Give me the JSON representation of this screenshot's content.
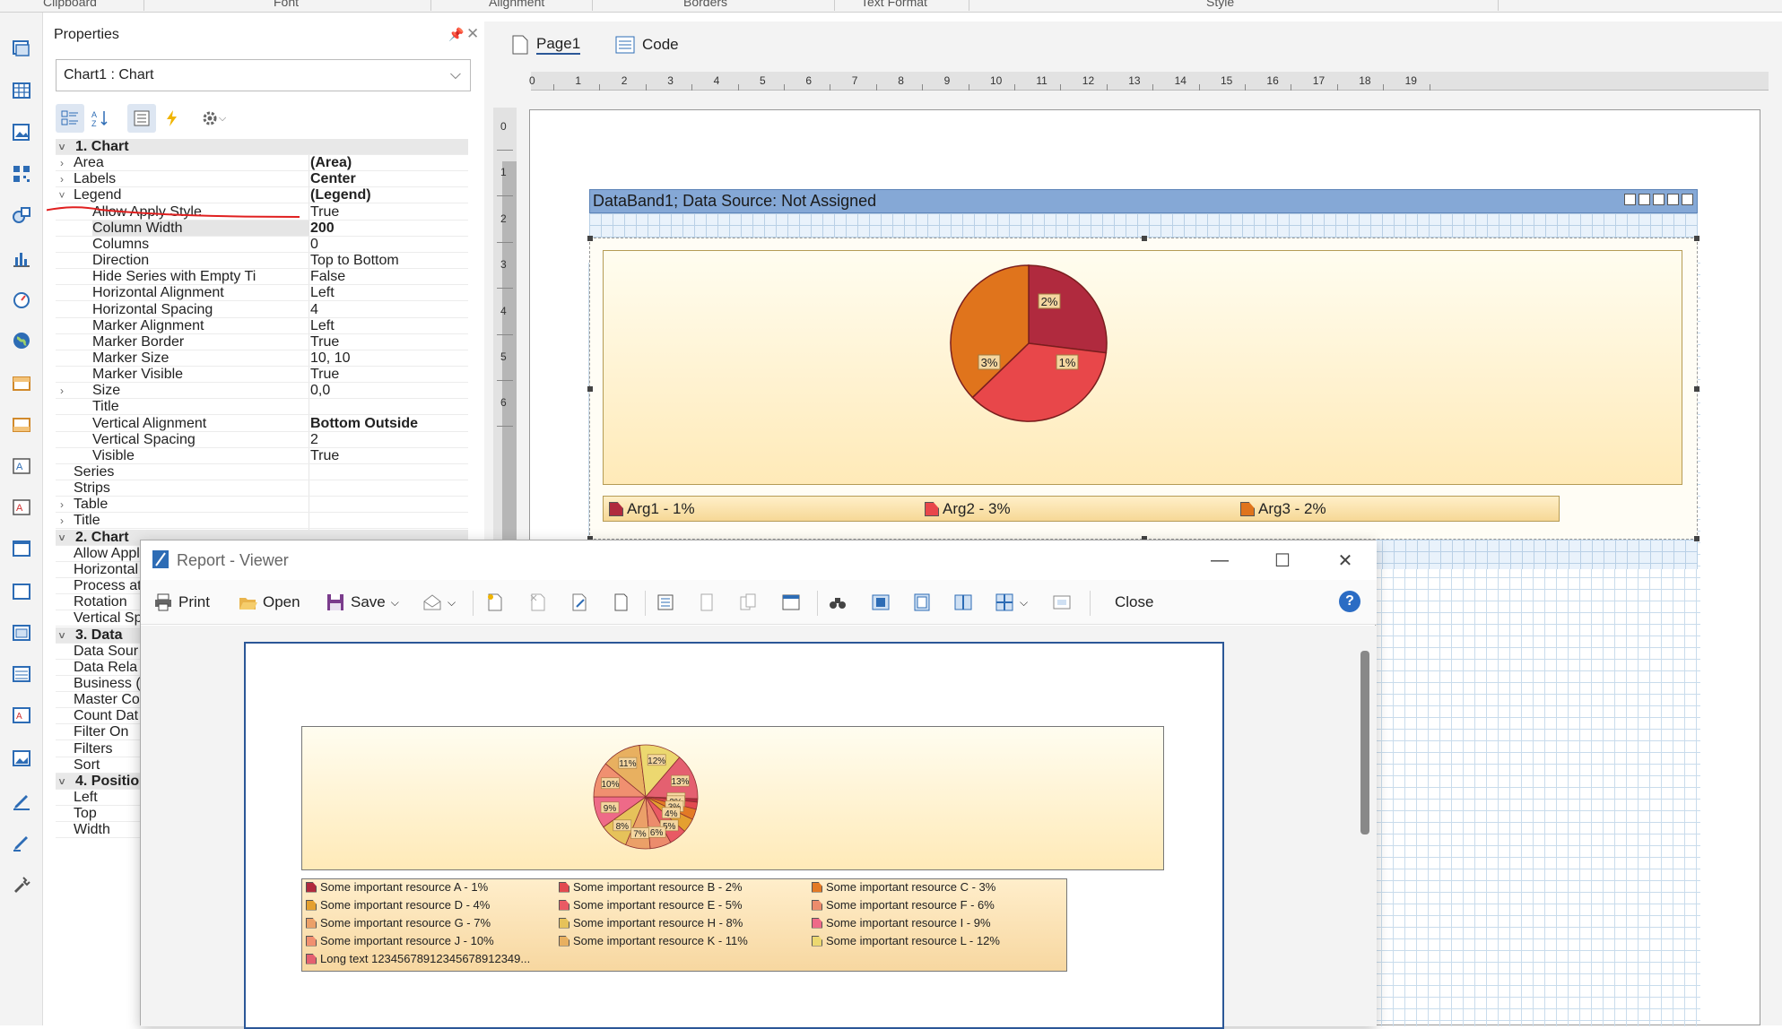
{
  "ribbon": {
    "groups": [
      "Clipboard",
      "Font",
      "Alignment",
      "Borders",
      "Text Format",
      "Style"
    ]
  },
  "properties": {
    "title": "Properties",
    "selected_component": "Chart1 : Chart",
    "rows": [
      {
        "kind": "cat",
        "expander": "˅",
        "name": "1. Chart",
        "value": ""
      },
      {
        "kind": "top",
        "expander": "›",
        "name": "Area",
        "value": "(Area)",
        "bold": true
      },
      {
        "kind": "top",
        "expander": "›",
        "name": "Labels",
        "value": "Center",
        "bold": true
      },
      {
        "kind": "top",
        "expander": "˅",
        "name": "Legend",
        "value": "(Legend)",
        "bold": true
      },
      {
        "kind": "sub",
        "expander": "",
        "name": "Allow Apply Style",
        "value": "True"
      },
      {
        "kind": "sub",
        "expander": "",
        "name": "Column Width",
        "value": "200",
        "bold": true,
        "selected": true
      },
      {
        "kind": "sub",
        "expander": "",
        "name": "Columns",
        "value": "0"
      },
      {
        "kind": "sub",
        "expander": "",
        "name": "Direction",
        "value": "Top to Bottom"
      },
      {
        "kind": "sub",
        "expander": "",
        "name": "Hide Series with Empty Ti",
        "value": "False"
      },
      {
        "kind": "sub",
        "expander": "",
        "name": "Horizontal Alignment",
        "value": "Left"
      },
      {
        "kind": "sub",
        "expander": "",
        "name": "Horizontal Spacing",
        "value": "4"
      },
      {
        "kind": "sub",
        "expander": "",
        "name": "Marker Alignment",
        "value": "Left"
      },
      {
        "kind": "sub",
        "expander": "",
        "name": "Marker Border",
        "value": "True"
      },
      {
        "kind": "sub",
        "expander": "",
        "name": "Marker Size",
        "value": "10, 10"
      },
      {
        "kind": "sub",
        "expander": "",
        "name": "Marker Visible",
        "value": "True"
      },
      {
        "kind": "sub",
        "expander": "›",
        "name": "Size",
        "value": "0,0"
      },
      {
        "kind": "sub",
        "expander": "",
        "name": "Title",
        "value": ""
      },
      {
        "kind": "sub",
        "expander": "",
        "name": "Vertical Alignment",
        "value": "Bottom Outside",
        "bold": true
      },
      {
        "kind": "sub",
        "expander": "",
        "name": "Vertical Spacing",
        "value": "2"
      },
      {
        "kind": "sub",
        "expander": "",
        "name": "Visible",
        "value": "True"
      },
      {
        "kind": "top",
        "expander": "",
        "name": "Series",
        "value": ""
      },
      {
        "kind": "top",
        "expander": "",
        "name": "Strips",
        "value": ""
      },
      {
        "kind": "top",
        "expander": "›",
        "name": "Table",
        "value": ""
      },
      {
        "kind": "top",
        "expander": "›",
        "name": "Title",
        "value": ""
      },
      {
        "kind": "cat",
        "expander": "˅",
        "name": "2. Chart",
        "value": ""
      },
      {
        "kind": "top",
        "expander": "",
        "name": "Allow Appl",
        "value": ""
      },
      {
        "kind": "top",
        "expander": "",
        "name": "Horizontal",
        "value": ""
      },
      {
        "kind": "top",
        "expander": "",
        "name": "Process at",
        "value": ""
      },
      {
        "kind": "top",
        "expander": "",
        "name": "Rotation",
        "value": ""
      },
      {
        "kind": "top",
        "expander": "",
        "name": "Vertical Sp",
        "value": ""
      },
      {
        "kind": "cat",
        "expander": "˅",
        "name": "3. Data",
        "value": ""
      },
      {
        "kind": "top",
        "expander": "",
        "name": "Data Sour",
        "value": ""
      },
      {
        "kind": "top",
        "expander": "",
        "name": "Data Rela",
        "value": ""
      },
      {
        "kind": "top",
        "expander": "",
        "name": "Business (",
        "value": ""
      },
      {
        "kind": "top",
        "expander": "",
        "name": "Master Co",
        "value": ""
      },
      {
        "kind": "top",
        "expander": "",
        "name": "Count Dat",
        "value": ""
      },
      {
        "kind": "top",
        "expander": "",
        "name": "Filter On",
        "value": ""
      },
      {
        "kind": "top",
        "expander": "",
        "name": "Filters",
        "value": ""
      },
      {
        "kind": "top",
        "expander": "",
        "name": "Sort",
        "value": ""
      },
      {
        "kind": "cat",
        "expander": "˅",
        "name": "4. Positio",
        "value": ""
      },
      {
        "kind": "top",
        "expander": "",
        "name": "Left",
        "value": ""
      },
      {
        "kind": "top",
        "expander": "",
        "name": "Top",
        "value": ""
      },
      {
        "kind": "top",
        "expander": "",
        "name": "Width",
        "value": ""
      }
    ]
  },
  "designer": {
    "tabs": [
      "Page1",
      "Code"
    ],
    "ruler_numbers": [
      "0",
      "1",
      "2",
      "3",
      "4",
      "5",
      "6",
      "7",
      "8",
      "9",
      "10",
      "11",
      "12",
      "13",
      "14",
      "15",
      "16",
      "17",
      "18",
      "19"
    ],
    "vruler_numbers": [
      "0",
      "1",
      "2",
      "3",
      "4",
      "5",
      "6"
    ],
    "band_title": "DataBand1; Data Source: Not Assigned",
    "pie": [
      {
        "label": "1%",
        "color": "#b02a3e"
      },
      {
        "label": "3%",
        "color": "#e8474a"
      },
      {
        "label": "2%",
        "color": "#e0741c"
      }
    ],
    "legend": [
      {
        "label": "Arg1 - 1%",
        "color": "#b02a3e"
      },
      {
        "label": "Arg2 - 3%",
        "color": "#e8474a"
      },
      {
        "label": "Arg3 - 2%",
        "color": "#e0741c"
      }
    ]
  },
  "viewer": {
    "title": "Report - Viewer",
    "toolbar": {
      "print": "Print",
      "open": "Open",
      "save": "Save",
      "close": "Close"
    },
    "help": "?",
    "pie_labels": [
      "12%",
      "13%",
      "1%",
      "3%",
      "4%",
      "5%",
      "2%",
      "6%",
      "7%",
      "8%",
      "9%",
      "10%",
      "11%"
    ],
    "legend": [
      {
        "label": "Some important resource A - 1%",
        "color": "#b02a3e"
      },
      {
        "label": "Some important resource B - 2%",
        "color": "#e24a50"
      },
      {
        "label": "Some important resource C - 3%",
        "color": "#e37a25"
      },
      {
        "label": "Some important resource D - 4%",
        "color": "#e4a030"
      },
      {
        "label": "Some important resource E - 5%",
        "color": "#e95a64"
      },
      {
        "label": "Some important resource F - 6%",
        "color": "#ec8c6c"
      },
      {
        "label": "Some important resource G - 7%",
        "color": "#eba068"
      },
      {
        "label": "Some important resource H - 8%",
        "color": "#e6c25a"
      },
      {
        "label": "Some important resource I - 9%",
        "color": "#ee6a88"
      },
      {
        "label": "Some important resource J - 10%",
        "color": "#f09070"
      },
      {
        "label": "Some important resource K - 11%",
        "color": "#e8b060"
      },
      {
        "label": "Some important resource L - 12%",
        "color": "#ecd870"
      },
      {
        "label": "Long text 12345678912345678912349...",
        "color": "#e46070"
      }
    ]
  }
}
